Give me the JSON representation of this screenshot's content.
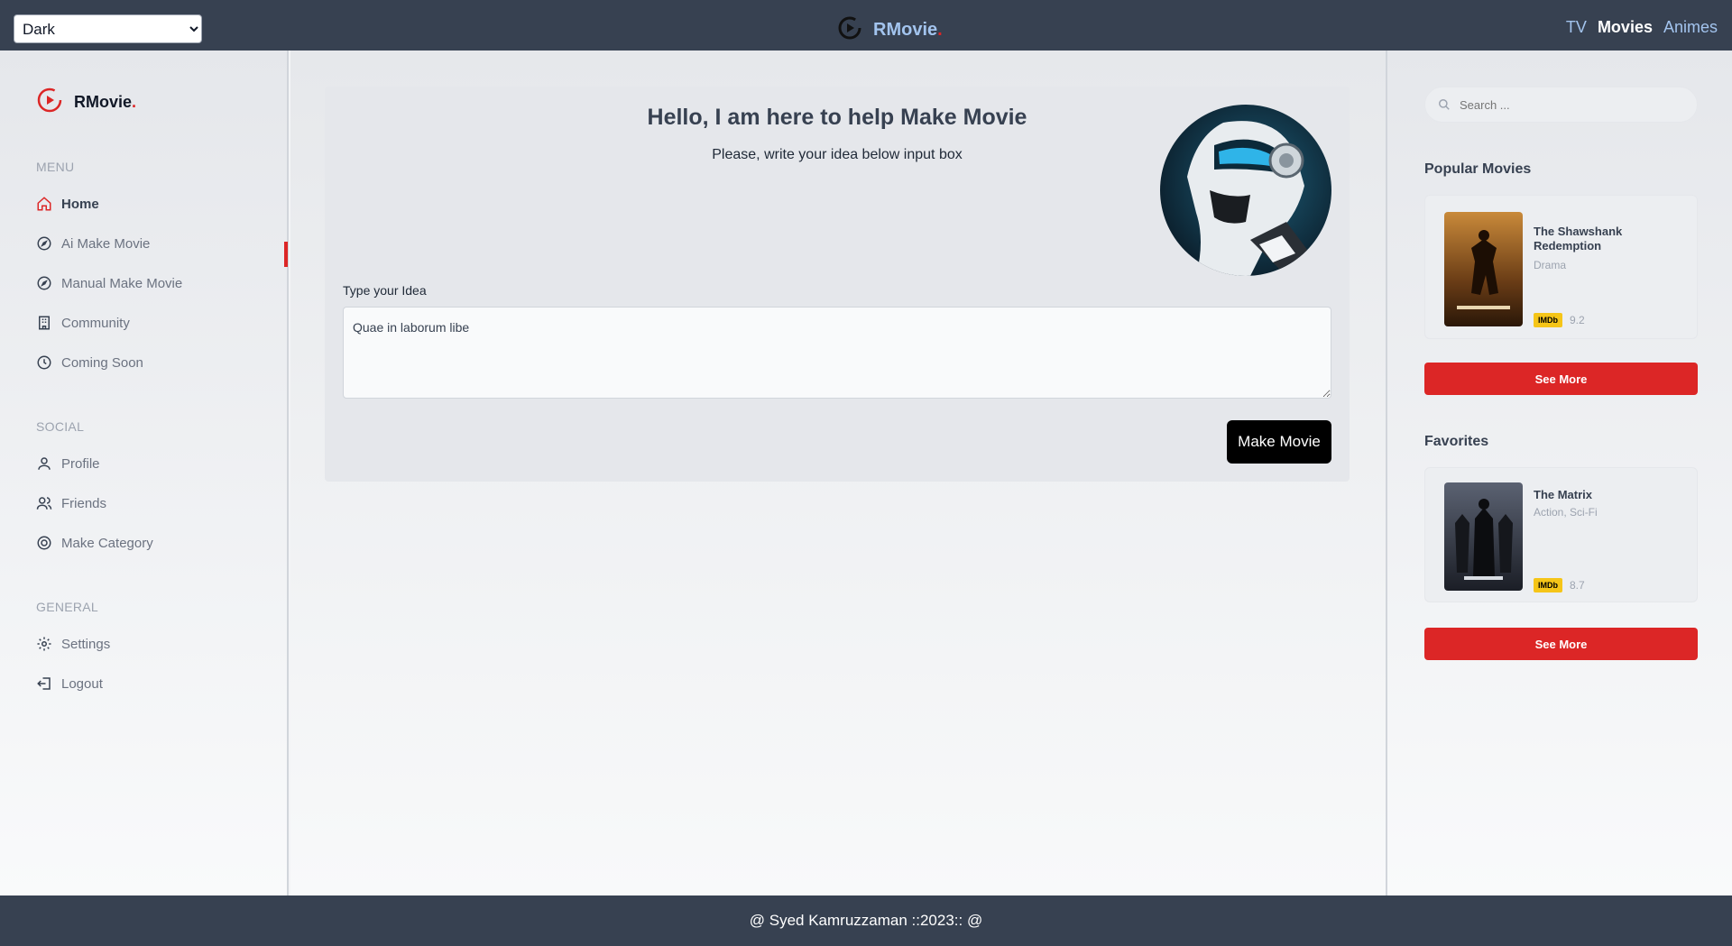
{
  "topbar": {
    "theme_value": "Dark",
    "theme_options": [
      "Dark"
    ],
    "brand": "RMovie",
    "brand_dot": ".",
    "nav": [
      {
        "label": "TV",
        "active": false
      },
      {
        "label": "Movies",
        "active": true
      },
      {
        "label": "Animes",
        "active": false
      }
    ]
  },
  "sidebar": {
    "brand": "RMovie",
    "brand_dot": ".",
    "sections": {
      "menu": "MENU",
      "social": "SOCIAL",
      "general": "GENERAL"
    },
    "menu_items": [
      {
        "label": "Home",
        "icon": "home-icon"
      },
      {
        "label": "Ai Make Movie",
        "icon": "compass-icon"
      },
      {
        "label": "Manual Make Movie",
        "icon": "compass-icon"
      },
      {
        "label": "Community",
        "icon": "building-icon"
      },
      {
        "label": "Coming Soon",
        "icon": "clock-icon"
      }
    ],
    "social_items": [
      {
        "label": "Profile",
        "icon": "user-icon"
      },
      {
        "label": "Friends",
        "icon": "users-icon"
      },
      {
        "label": "Make Category",
        "icon": "target-icon"
      }
    ],
    "general_items": [
      {
        "label": "Settings",
        "icon": "gear-icon"
      },
      {
        "label": "Logout",
        "icon": "logout-icon"
      }
    ]
  },
  "main": {
    "title": "Hello, I am here to help Make Movie",
    "subtitle": "Please, write your idea below input box",
    "idea_label": "Type your Idea",
    "idea_value": "Quae in laborum libe",
    "submit_label": "Make Movie"
  },
  "rightbar": {
    "search_placeholder": "Search ...",
    "popular_title": "Popular Movies",
    "popular": {
      "title": "The Shawshank Redemption",
      "genre": "Drama",
      "imdb": "IMDb",
      "rating": "9.2"
    },
    "favorites_title": "Favorites",
    "favorite": {
      "title": "The Matrix",
      "genre": "Action, Sci-Fi",
      "imdb": "IMDb",
      "rating": "8.7"
    },
    "see_more": "See More"
  },
  "footer": {
    "text": "@ Syed Kamruzzaman ::2023:: @"
  },
  "colors": {
    "accent": "#dc2626",
    "header": "#374151",
    "brand_text": "#a3c4ee",
    "imdb": "#f5c518"
  }
}
